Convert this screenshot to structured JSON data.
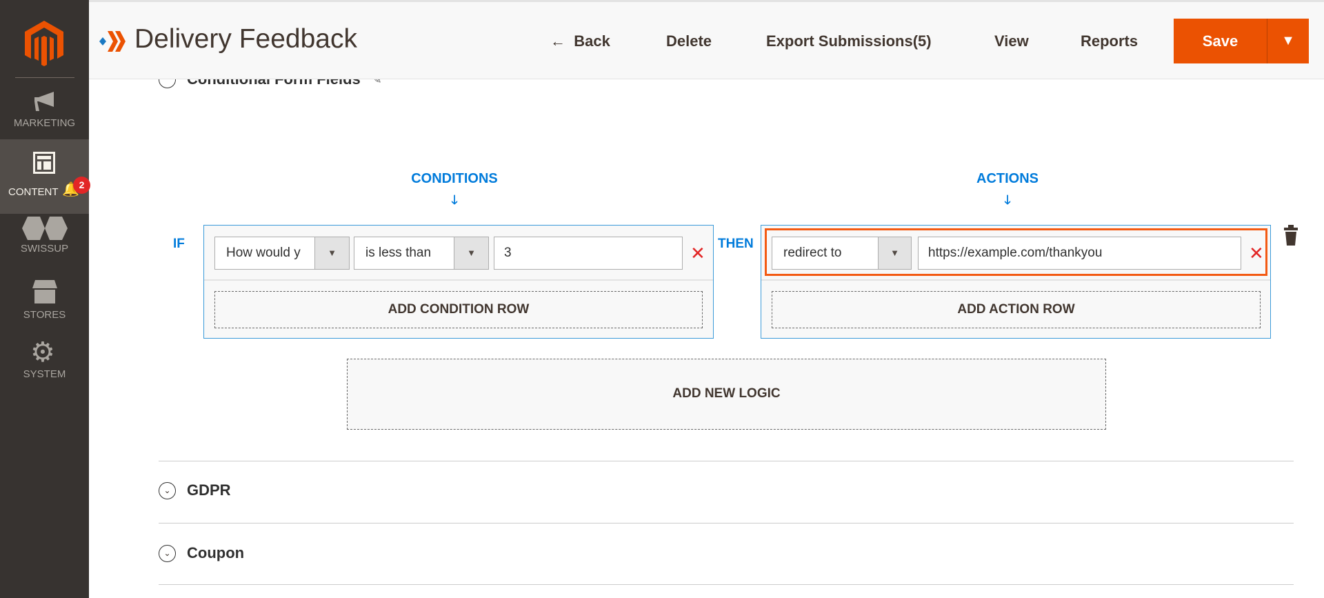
{
  "sidebar": {
    "items": [
      {
        "label": "MARKETING",
        "icon": "megaphone-icon"
      },
      {
        "label": "CONTENT",
        "icon": "layout-icon",
        "active": true,
        "notifications": "2"
      },
      {
        "label": "SWISSUP",
        "icon": "swissup-icon"
      },
      {
        "label": "STORES",
        "icon": "store-icon"
      },
      {
        "label": "SYSTEM",
        "icon": "gear-icon"
      }
    ]
  },
  "header": {
    "title": "Delivery Feedback",
    "back": "Back",
    "delete": "Delete",
    "export": "Export Submissions(5)",
    "view": "View",
    "reports": "Reports",
    "save": "Save"
  },
  "sections": {
    "conditional": "Conditional Form Fields",
    "gdpr": "GDPR",
    "coupon": "Coupon"
  },
  "logic": {
    "conditions_label": "CONDITIONS",
    "actions_label": "ACTIONS",
    "if": "IF",
    "then": "THEN",
    "condition": {
      "field": "How would y",
      "operator": "is less than",
      "value": "3"
    },
    "action": {
      "type": "redirect to",
      "value": "https://example.com/thankyou"
    },
    "add_condition": "ADD CONDITION ROW",
    "add_action": "ADD ACTION ROW",
    "add_logic": "ADD NEW LOGIC"
  },
  "colors": {
    "accent": "#eb5202",
    "link": "#007bdb",
    "sidebar": "#373330"
  }
}
